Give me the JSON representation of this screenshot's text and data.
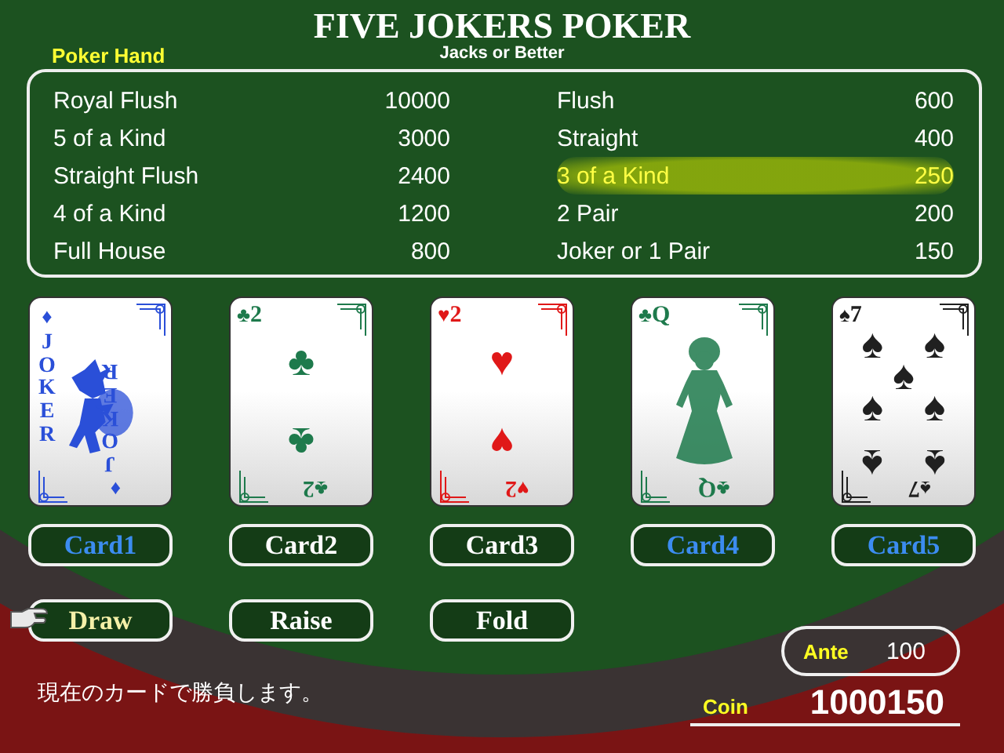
{
  "title": "FIVE JOKERS POKER",
  "subtitle": "Jacks or Better",
  "paytable": {
    "label": "Poker Hand",
    "rows": [
      {
        "hand": "Royal Flush",
        "payout": "10000",
        "selected": false
      },
      {
        "hand": "5 of a Kind",
        "payout": "3000",
        "selected": false
      },
      {
        "hand": "Straight Flush",
        "payout": "2400",
        "selected": false
      },
      {
        "hand": "4 of a Kind",
        "payout": "1200",
        "selected": false
      },
      {
        "hand": "Full House",
        "payout": "800",
        "selected": false
      },
      {
        "hand": "Flush",
        "payout": "600",
        "selected": false
      },
      {
        "hand": "Straight",
        "payout": "400",
        "selected": false
      },
      {
        "hand": "3 of a Kind",
        "payout": "250",
        "selected": true
      },
      {
        "hand": "2 Pair",
        "payout": "200",
        "selected": false
      },
      {
        "hand": "Joker or 1 Pair",
        "payout": "150",
        "selected": false
      }
    ]
  },
  "cards": [
    {
      "kind": "joker",
      "color": "#2a4fd8",
      "corners": [
        {
          "suit": "♦",
          "rank": "JOKER"
        },
        {
          "suit": "♦",
          "rank": "JOKER"
        }
      ]
    },
    {
      "kind": "number",
      "color": "#1e7a4c",
      "corners": [
        {
          "suit": "♣",
          "rank": "2"
        },
        {
          "suit": "♣",
          "rank": "2"
        }
      ],
      "pips": [
        "♣",
        "♣"
      ]
    },
    {
      "kind": "number",
      "color": "#e01818",
      "corners": [
        {
          "suit": "♥",
          "rank": "2"
        },
        {
          "suit": "♥",
          "rank": "2"
        }
      ],
      "pips": [
        "♥",
        "♥"
      ]
    },
    {
      "kind": "face",
      "color": "#1e7a4c",
      "corners": [
        {
          "suit": "♣",
          "rank": "Q"
        },
        {
          "suit": "♣",
          "rank": "Q"
        }
      ]
    },
    {
      "kind": "number",
      "color": "#202020",
      "corners": [
        {
          "suit": "♠",
          "rank": "7"
        },
        {
          "suit": "♠",
          "rank": "7"
        }
      ],
      "pips": [
        "♠",
        "♠",
        "♠",
        "♠",
        "♠",
        "♠",
        "♠"
      ]
    }
  ],
  "card_buttons": [
    {
      "label": "Card1",
      "selected": true
    },
    {
      "label": "Card2",
      "selected": false
    },
    {
      "label": "Card3",
      "selected": false
    },
    {
      "label": "Card4",
      "selected": true
    },
    {
      "label": "Card5",
      "selected": true
    }
  ],
  "action_buttons": [
    {
      "label": "Draw",
      "focused": true
    },
    {
      "label": "Raise",
      "focused": false
    },
    {
      "label": "Fold",
      "focused": false
    }
  ],
  "ante": {
    "label": "Ante",
    "value": "100"
  },
  "message": "現在のカードで勝負します。",
  "coin": {
    "label": "Coin",
    "value": "1000150"
  }
}
